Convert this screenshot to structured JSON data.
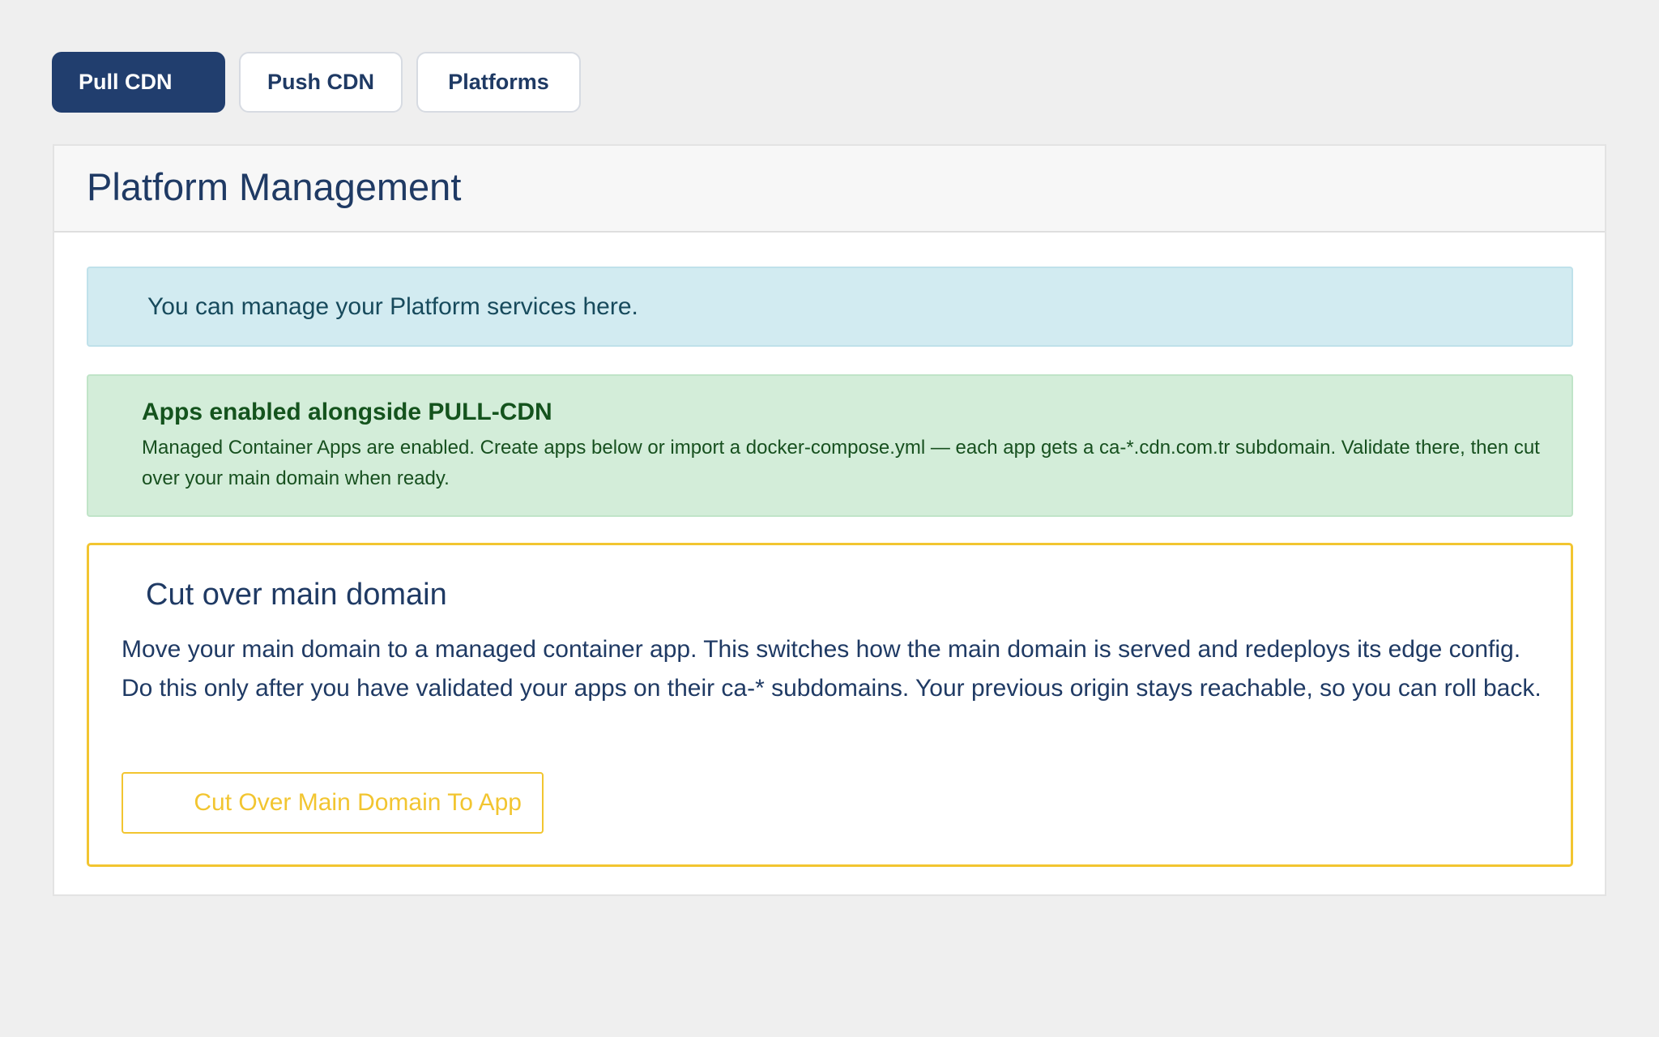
{
  "tabs": [
    {
      "label": "Pull CDN",
      "active": true
    },
    {
      "label": "Push CDN",
      "active": false
    },
    {
      "label": "Platforms",
      "active": false
    }
  ],
  "panel": {
    "title": "Platform Management"
  },
  "info_alert": {
    "text": "You can manage your Platform services here."
  },
  "success_alert": {
    "title": "Apps enabled alongside PULL-CDN",
    "body": "Managed Container Apps are enabled. Create apps below or import a docker-compose.yml — each app gets a ca-*.cdn.com.tr subdomain. Validate there, then cut over your main domain when ready."
  },
  "cutover": {
    "title": "Cut over main domain",
    "body": "Move your main domain to a managed container app. This switches how the main domain is served and redeploys its edge config. Do this only after you have validated your apps on their ca-* subdomains. Your previous origin stays reachable, so you can roll back.",
    "button_label": "Cut Over Main Domain To App"
  },
  "colors": {
    "primary": "#213e6e",
    "info_bg": "#d2ebf1",
    "success_bg": "#d3edd9",
    "warning": "#f2c530"
  }
}
